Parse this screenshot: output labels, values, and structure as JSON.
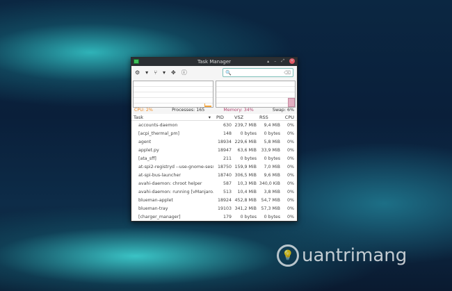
{
  "window": {
    "title": "Task Manager",
    "controls": [
      "▴",
      "–",
      "⤢",
      "✕"
    ]
  },
  "toolbar": {
    "search_placeholder": "",
    "search_icon": "🔍",
    "clear_icon": "⌫"
  },
  "status": {
    "cpu": "CPU: 2%",
    "processes": "Processes: 165",
    "memory": "Memory: 34%",
    "swap": "Swap: 6%"
  },
  "colors": {
    "cpu": "#f08a24",
    "memory": "#b0436e"
  },
  "columns": {
    "task": "Task",
    "pid": "PID",
    "vsz": "VSZ",
    "rss": "RSS",
    "cpu": "CPU"
  },
  "rows": [
    {
      "task": "accounts-daemon",
      "pid": "630",
      "vsz": "239,7 MiB",
      "rss": "9,4 MiB",
      "cpu": "0%"
    },
    {
      "task": "[acpi_thermal_pm]",
      "pid": "148",
      "vsz": "0 bytes",
      "rss": "0 bytes",
      "cpu": "0%"
    },
    {
      "task": "agent",
      "pid": "18934",
      "vsz": "229,6 MiB",
      "rss": "5,8 MiB",
      "cpu": "0%"
    },
    {
      "task": "applet.py",
      "pid": "18947",
      "vsz": "63,6 MiB",
      "rss": "33,9 MiB",
      "cpu": "0%"
    },
    {
      "task": "[ata_sff]",
      "pid": "211",
      "vsz": "0 bytes",
      "rss": "0 bytes",
      "cpu": "0%"
    },
    {
      "task": "at-spi2-registryd --use-gnome-sessi...",
      "pid": "18750",
      "vsz": "159,9 MiB",
      "rss": "7,0 MiB",
      "cpu": "0%"
    },
    {
      "task": "at-spi-bus-launcher",
      "pid": "18740",
      "vsz": "306,5 MiB",
      "rss": "9,6 MiB",
      "cpu": "0%"
    },
    {
      "task": "avahi-daemon: chroot helper",
      "pid": "587",
      "vsz": "10,3 MiB",
      "rss": "340,0 KiB",
      "cpu": "0%"
    },
    {
      "task": "avahi-daemon: running [vManjaro.l...",
      "pid": "513",
      "vsz": "10,4 MiB",
      "rss": "3,8 MiB",
      "cpu": "0%"
    },
    {
      "task": "blueman-applet",
      "pid": "18924",
      "vsz": "452,8 MiB",
      "rss": "54,7 MiB",
      "cpu": "0%"
    },
    {
      "task": "blueman-tray",
      "pid": "19103",
      "vsz": "341,2 MiB",
      "rss": "57,3 MiB",
      "cpu": "0%"
    },
    {
      "task": "[charger_manager]",
      "pid": "179",
      "vsz": "0 bytes",
      "rss": "0 bytes",
      "cpu": "0%"
    }
  ],
  "watermark": "uantrimang"
}
